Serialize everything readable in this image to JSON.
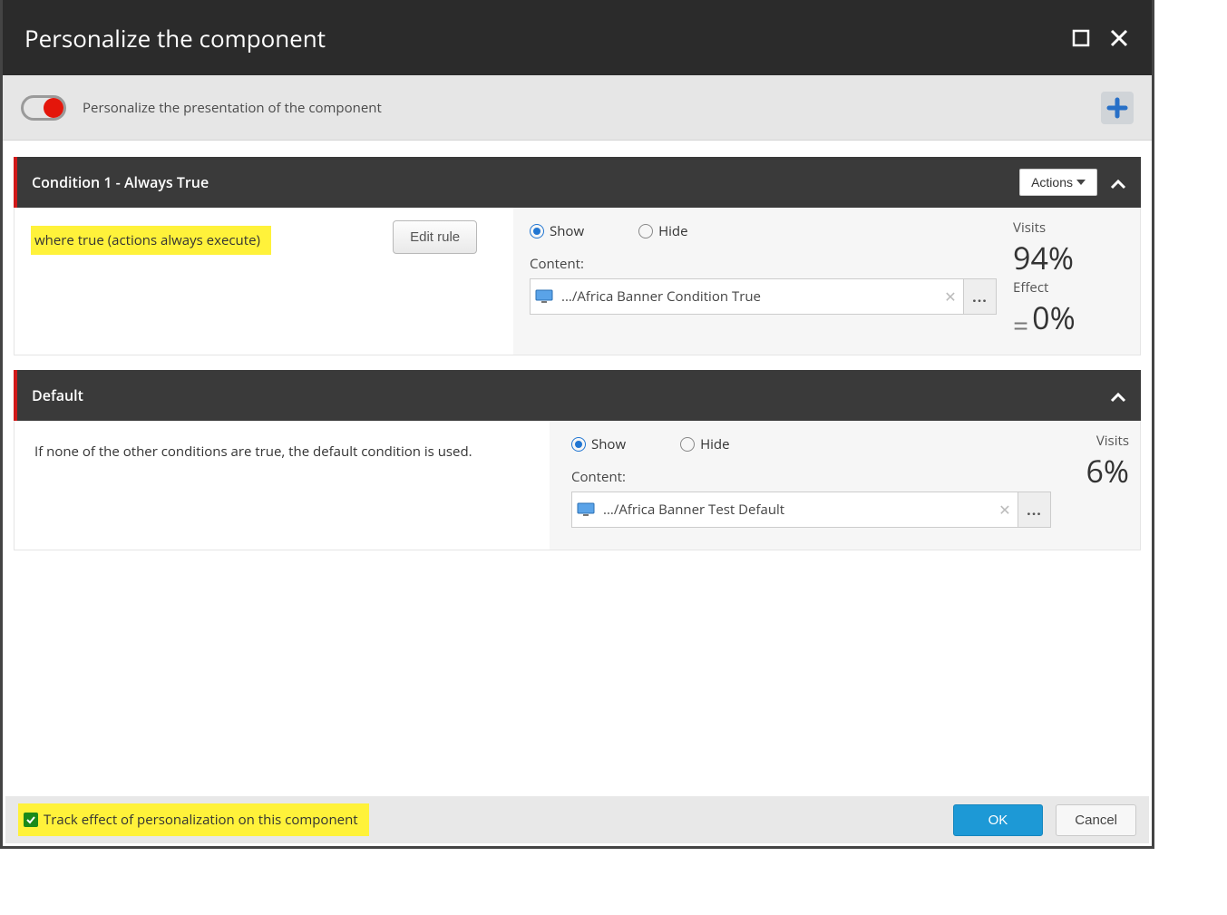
{
  "dialog": {
    "title": "Personalize the component"
  },
  "toolbar": {
    "toggle_label": "Personalize the presentation of the component"
  },
  "conditions": [
    {
      "header_title": "Condition 1 - Always True",
      "actions_label": "Actions",
      "rule_text": "where true (actions always execute)",
      "edit_rule_label": "Edit rule",
      "show_label": "Show",
      "hide_label": "Hide",
      "content_label": "Content:",
      "content_value": ".../Africa Banner Condition True",
      "browse_label": "...",
      "visits_label": "Visits",
      "visits_value": "94%",
      "effect_label": "Effect",
      "effect_value": "0%"
    },
    {
      "header_title": "Default",
      "description": "If none of the other conditions are true, the default condition is used.",
      "show_label": "Show",
      "hide_label": "Hide",
      "content_label": "Content:",
      "content_value": ".../Africa Banner Test Default",
      "browse_label": "...",
      "visits_label": "Visits",
      "visits_value": "6%"
    }
  ],
  "footer": {
    "track_label": "Track effect of personalization on this component",
    "ok_label": "OK",
    "cancel_label": "Cancel"
  }
}
